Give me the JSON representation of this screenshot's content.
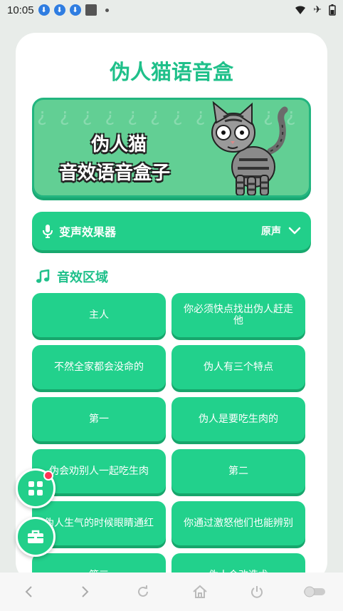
{
  "status_bar": {
    "time": "10:05"
  },
  "app": {
    "title": "伪人猫语音盒"
  },
  "banner": {
    "line1": "伪人猫",
    "line2": "音效语音盒子"
  },
  "effect": {
    "label": "变声效果器",
    "value": "原声"
  },
  "section": {
    "title": "音效区域"
  },
  "sounds": [
    "主人",
    "你必须快点找出伪人赶走他",
    "不然全家都会没命的",
    "伪人有三个特点",
    "第一",
    "伪人是要吃生肉的",
    "伪会劝别人一起吃生肉",
    "第二",
    "伪人生气的时候眼睛通红",
    "你通过激怒他们也能辨别",
    "第三",
    "伪人会改造术"
  ],
  "colors": {
    "accent": "#22d18c",
    "title": "#1fc08a",
    "badge": "#ff3355"
  }
}
